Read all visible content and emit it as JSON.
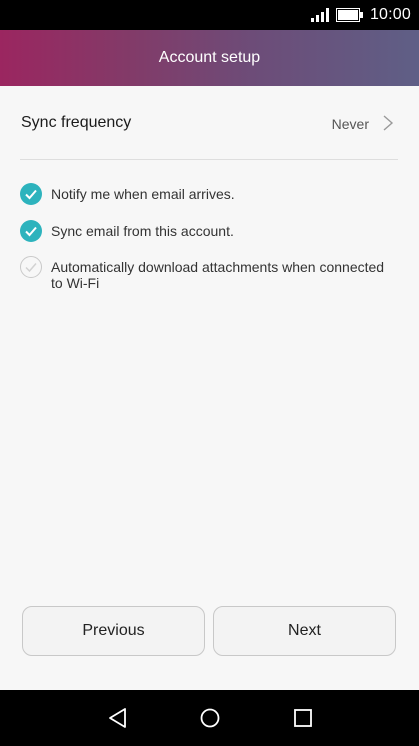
{
  "status_bar": {
    "time": "10:00",
    "icons": [
      "signal-icon",
      "battery-icon"
    ]
  },
  "header": {
    "title": "Account setup",
    "gradient": [
      "#9b2660",
      "#5f5f86"
    ]
  },
  "sync": {
    "label": "Sync frequency",
    "value": "Never",
    "icon": "chevron-right-icon"
  },
  "options": [
    {
      "label": "Notify me when email arrives.",
      "checked": true
    },
    {
      "label": "Sync email from this account.",
      "checked": true
    },
    {
      "label": "Automatically download attachments when connected to Wi-Fi",
      "checked": false
    }
  ],
  "buttons": {
    "previous": "Previous",
    "next": "Next"
  },
  "navbar": {
    "icons": [
      "back-icon",
      "home-icon",
      "recents-icon"
    ]
  },
  "colors": {
    "accent": "#2db3bd",
    "background": "#f7f7f7"
  }
}
